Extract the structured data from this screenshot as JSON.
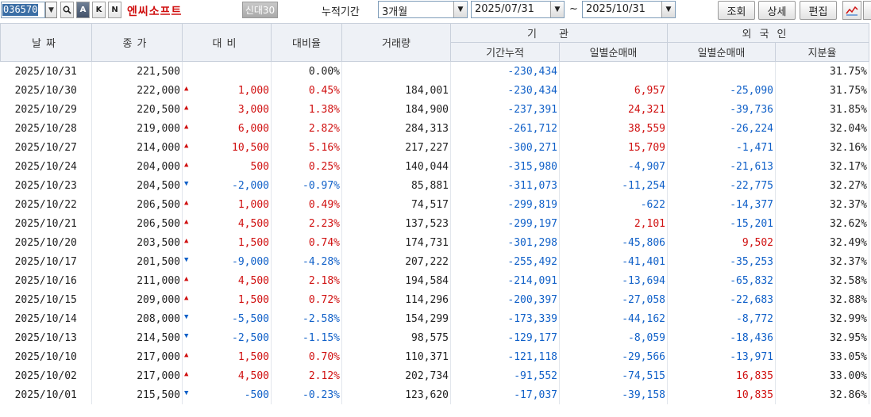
{
  "toolbar": {
    "stock_code": "036570",
    "btn_a": "A",
    "btn_k": "K",
    "btn_n": "N",
    "stock_name": "엔씨소프트",
    "credit_label": "신대30",
    "period_label": "누적기간",
    "period_value": "3개월",
    "date_from": "2025/07/31",
    "tilde": "~",
    "date_to": "2025/10/31",
    "search_label": "조회",
    "detail_label": "상세",
    "edit_label": "편집"
  },
  "headers": {
    "date": "날짜",
    "close": "종가",
    "change": "대비",
    "change_rate": "대비율",
    "volume": "거래량",
    "institution": "기관",
    "inst_cum": "기간누적",
    "inst_daily": "일별순매매",
    "foreign": "외국인",
    "frgn_daily": "일별순매매",
    "frgn_ratio": "지분율"
  },
  "colors": {
    "up": "#d01010",
    "down": "#1060c8",
    "header_bg": "#eef1f6"
  },
  "rows": [
    {
      "date": "2025/10/31",
      "close": "221,500",
      "dir": "none",
      "change": "",
      "rate": "0.00%",
      "volume": "",
      "inst_cum": "-230,434",
      "inst_daily": "",
      "frgn_daily": "",
      "ratio": "31.75%"
    },
    {
      "date": "2025/10/30",
      "close": "222,000",
      "dir": "up",
      "change": "1,000",
      "rate": "0.45%",
      "volume": "184,001",
      "inst_cum": "-230,434",
      "inst_daily": "6,957",
      "frgn_daily": "-25,090",
      "ratio": "31.75%"
    },
    {
      "date": "2025/10/29",
      "close": "220,500",
      "dir": "up",
      "change": "3,000",
      "rate": "1.38%",
      "volume": "184,900",
      "inst_cum": "-237,391",
      "inst_daily": "24,321",
      "frgn_daily": "-39,736",
      "ratio": "31.85%"
    },
    {
      "date": "2025/10/28",
      "close": "219,000",
      "dir": "up",
      "change": "6,000",
      "rate": "2.82%",
      "volume": "284,313",
      "inst_cum": "-261,712",
      "inst_daily": "38,559",
      "frgn_daily": "-26,224",
      "ratio": "32.04%"
    },
    {
      "date": "2025/10/27",
      "close": "214,000",
      "dir": "up",
      "change": "10,500",
      "rate": "5.16%",
      "volume": "217,227",
      "inst_cum": "-300,271",
      "inst_daily": "15,709",
      "frgn_daily": "-1,471",
      "ratio": "32.16%"
    },
    {
      "date": "2025/10/24",
      "close": "204,000",
      "dir": "up",
      "change": "500",
      "rate": "0.25%",
      "volume": "140,044",
      "inst_cum": "-315,980",
      "inst_daily": "-4,907",
      "frgn_daily": "-21,613",
      "ratio": "32.17%"
    },
    {
      "date": "2025/10/23",
      "close": "204,500",
      "dir": "down",
      "change": "-2,000",
      "rate": "-0.97%",
      "volume": "85,881",
      "inst_cum": "-311,073",
      "inst_daily": "-11,254",
      "frgn_daily": "-22,775",
      "ratio": "32.27%"
    },
    {
      "date": "2025/10/22",
      "close": "206,500",
      "dir": "up",
      "change": "1,000",
      "rate": "0.49%",
      "volume": "74,517",
      "inst_cum": "-299,819",
      "inst_daily": "-622",
      "frgn_daily": "-14,377",
      "ratio": "32.37%"
    },
    {
      "date": "2025/10/21",
      "close": "206,500",
      "dir": "up",
      "change": "4,500",
      "rate": "2.23%",
      "volume": "137,523",
      "inst_cum": "-299,197",
      "inst_daily": "2,101",
      "frgn_daily": "-15,201",
      "ratio": "32.62%"
    },
    {
      "date": "2025/10/20",
      "close": "203,500",
      "dir": "up",
      "change": "1,500",
      "rate": "0.74%",
      "volume": "174,731",
      "inst_cum": "-301,298",
      "inst_daily": "-45,806",
      "frgn_daily": "9,502",
      "ratio": "32.49%"
    },
    {
      "date": "2025/10/17",
      "close": "201,500",
      "dir": "down",
      "change": "-9,000",
      "rate": "-4.28%",
      "volume": "207,222",
      "inst_cum": "-255,492",
      "inst_daily": "-41,401",
      "frgn_daily": "-35,253",
      "ratio": "32.37%"
    },
    {
      "date": "2025/10/16",
      "close": "211,000",
      "dir": "up",
      "change": "4,500",
      "rate": "2.18%",
      "volume": "194,584",
      "inst_cum": "-214,091",
      "inst_daily": "-13,694",
      "frgn_daily": "-65,832",
      "ratio": "32.58%"
    },
    {
      "date": "2025/10/15",
      "close": "209,000",
      "dir": "up",
      "change": "1,500",
      "rate": "0.72%",
      "volume": "114,296",
      "inst_cum": "-200,397",
      "inst_daily": "-27,058",
      "frgn_daily": "-22,683",
      "ratio": "32.88%"
    },
    {
      "date": "2025/10/14",
      "close": "208,000",
      "dir": "down",
      "change": "-5,500",
      "rate": "-2.58%",
      "volume": "154,299",
      "inst_cum": "-173,339",
      "inst_daily": "-44,162",
      "frgn_daily": "-8,772",
      "ratio": "32.99%"
    },
    {
      "date": "2025/10/13",
      "close": "214,500",
      "dir": "down",
      "change": "-2,500",
      "rate": "-1.15%",
      "volume": "98,575",
      "inst_cum": "-129,177",
      "inst_daily": "-8,059",
      "frgn_daily": "-18,436",
      "ratio": "32.95%"
    },
    {
      "date": "2025/10/10",
      "close": "217,000",
      "dir": "up",
      "change": "1,500",
      "rate": "0.70%",
      "volume": "110,371",
      "inst_cum": "-121,118",
      "inst_daily": "-29,566",
      "frgn_daily": "-13,971",
      "ratio": "33.05%"
    },
    {
      "date": "2025/10/02",
      "close": "217,000",
      "dir": "up",
      "change": "4,500",
      "rate": "2.12%",
      "volume": "202,734",
      "inst_cum": "-91,552",
      "inst_daily": "-74,515",
      "frgn_daily": "16,835",
      "ratio": "33.00%"
    },
    {
      "date": "2025/10/01",
      "close": "215,500",
      "dir": "down",
      "change": "-500",
      "rate": "-0.23%",
      "volume": "123,620",
      "inst_cum": "-17,037",
      "inst_daily": "-39,158",
      "frgn_daily": "10,835",
      "ratio": "32.86%"
    }
  ]
}
